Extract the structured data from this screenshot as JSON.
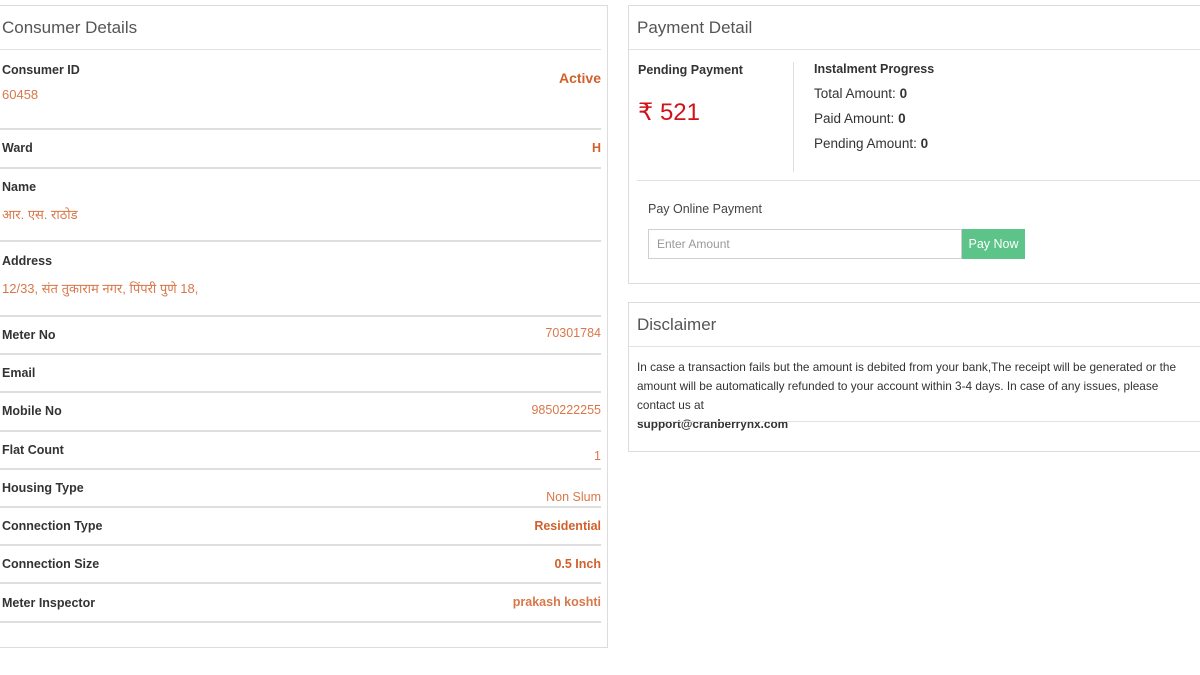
{
  "consumer": {
    "title": "Consumer Details",
    "rows": [
      {
        "label": "Consumer ID",
        "value": "60458",
        "status": "Active"
      },
      {
        "label": "Ward",
        "value": "H"
      },
      {
        "label": "Name",
        "value": "आर. एस. राठोड"
      },
      {
        "label": "Address",
        "value": "12/33, संत तुकाराम नगर, पिंपरी पुणे 18,"
      },
      {
        "label": "Meter No",
        "value": "70301784"
      },
      {
        "label": "Email",
        "value": ""
      },
      {
        "label": "Mobile No",
        "value": "9850222255"
      },
      {
        "label": "Flat Count",
        "value": "1"
      },
      {
        "label": "Housing Type",
        "value": "Non Slum"
      },
      {
        "label": "Connection Type",
        "value": "Residential"
      },
      {
        "label": "Connection Size",
        "value": "0.5 Inch"
      },
      {
        "label": "Meter Inspector",
        "value": "prakash koshti"
      }
    ]
  },
  "payment": {
    "title": "Payment Detail",
    "pending_label": "Pending Payment",
    "pending_amount": "₹ 521",
    "instalment_label": "Instalment Progress",
    "total_label": "Total Amount:",
    "total_value": "0",
    "paid_label": "Paid Amount:",
    "paid_value": "0",
    "pending_amount_label": "Pending Amount:",
    "pending_amount_value": "0",
    "online_label": "Pay Online Payment",
    "amount_placeholder": "Enter Amount",
    "pay_button": "Pay Now"
  },
  "disclaimer": {
    "title": "Disclaimer",
    "text": "In case a transaction fails but the amount is debited from your bank,The receipt will be generated or the amount will be automatically refunded to your account within 3-4 days. In case of any issues, please contact us at",
    "email": "support@cranberrynx.com"
  },
  "colors": {
    "value_orange": "#d2602a",
    "amount_red": "#d0121a",
    "pay_button_green": "#5cc488"
  }
}
